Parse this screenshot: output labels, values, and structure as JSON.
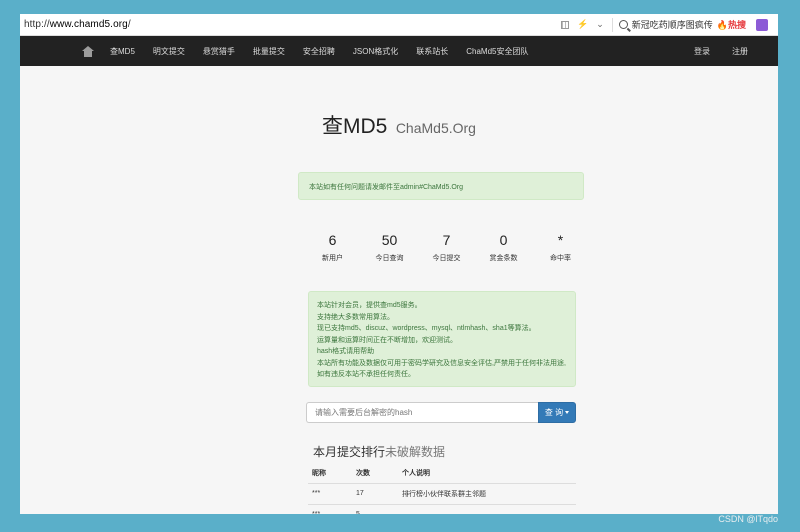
{
  "browser": {
    "url_prefix": "http://",
    "url_domain": "www.chamd5.org",
    "url_suffix": "/",
    "search_text": "新冠吃药顺序图疯传",
    "hot_label": "热搜"
  },
  "nav": {
    "items": [
      "查MD5",
      "明文提交",
      "悬赏猎手",
      "批量提交",
      "安全招聘",
      "JSON格式化",
      "联系站长",
      "ChaMd5安全团队"
    ],
    "login": "登录",
    "register": "注册"
  },
  "logo": {
    "main": "查MD5",
    "sub": "ChaMd5.Org"
  },
  "notice": "本站如有任何问题请发邮件至admin#ChaMd5.Org",
  "stats": [
    {
      "value": "6",
      "label": "新用户"
    },
    {
      "value": "50",
      "label": "今日查询"
    },
    {
      "value": "7",
      "label": "今日提交"
    },
    {
      "value": "0",
      "label": "赏金条数"
    },
    {
      "value": "*",
      "label": "命中率"
    }
  ],
  "info_lines": [
    "本站针对会员，提供查md5服务。",
    "支持绝大多数常用算法。",
    "现已支持md5、discuz、wordpress、mysql、ntlmhash、sha1等算法。",
    "运算量和运算时间正在不断增加，欢迎测试。",
    "hash格式请用帮助",
    "本站所有功能及数据仅可用于密码学研究及信息安全评估,严禁用于任何非法用途,",
    "如有违反本站不承担任何责任。"
  ],
  "search": {
    "placeholder": "请输入需要后台解密的hash",
    "button_label": "查 询"
  },
  "ranking": {
    "title_main": "本月提交排行",
    "title_muted": "未破解数据",
    "headers": [
      "昵称",
      "次数",
      "个人说明"
    ],
    "rows": [
      [
        "***",
        "17",
        "排行榜小伙伴联系群主邻题"
      ],
      [
        "***",
        "5",
        ""
      ]
    ]
  },
  "watermark": "CSDN @lTqdo"
}
